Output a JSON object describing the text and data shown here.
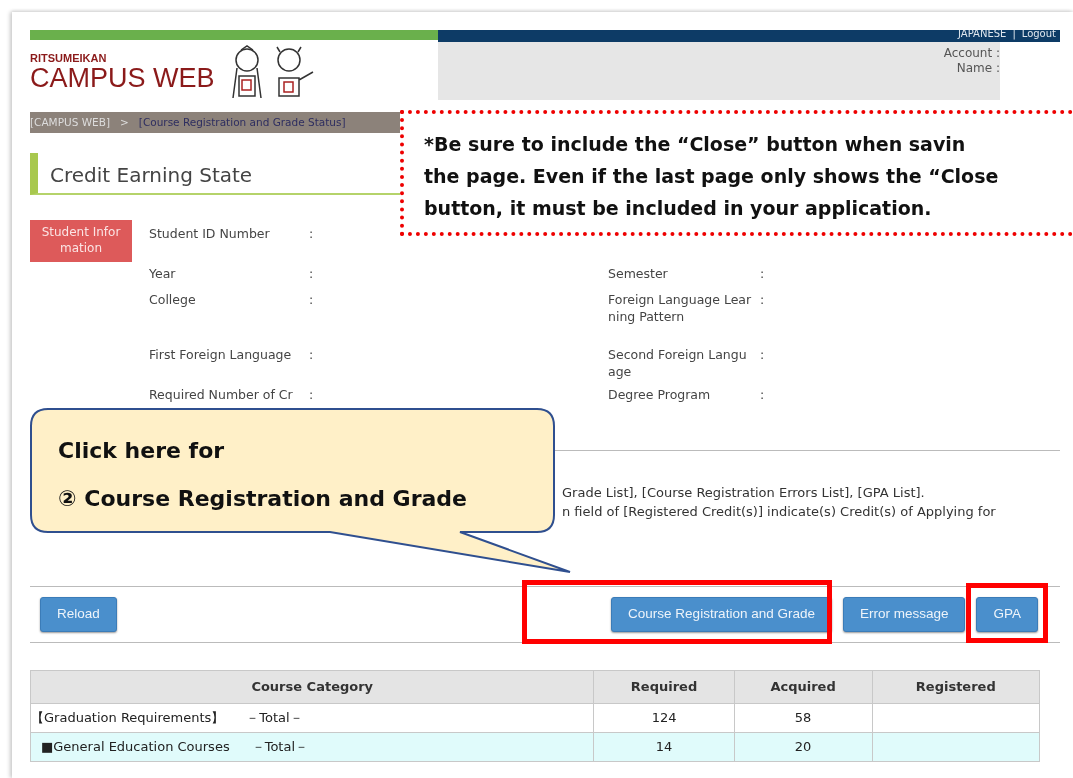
{
  "header": {
    "logo_top": "RITSUMEIKAN",
    "logo_main": "CAMPUS WEB",
    "links": [
      "JAPANESE",
      "|",
      "Logout"
    ],
    "account_label": "Account :",
    "name_label": "Name :"
  },
  "breadcrumb": [
    {
      "text": "[CAMPUS WEB]",
      "kind": "home"
    },
    {
      "text": ">",
      "kind": "sep"
    },
    {
      "text": "[Course Registration and Grade Status]",
      "kind": "current"
    }
  ],
  "page_title": "Credit Earning State",
  "student_info": {
    "badge": "Student Information",
    "rows": [
      {
        "left": {
          "label": "Student ID Number",
          "sep": ":"
        }
      },
      {
        "left": {
          "label": "Year",
          "sep": ":"
        },
        "right": {
          "label": "Semester",
          "sep": ":"
        }
      },
      {
        "left": {
          "label": "College",
          "sep": ":"
        },
        "right": {
          "label": "Foreign Language Learning Pattern",
          "sep": ":"
        }
      },
      {
        "left": {
          "label": "First Foreign Language",
          "sep": ":"
        },
        "right": {
          "label": "Second Foreign Language",
          "sep": ":"
        }
      },
      {
        "left": {
          "label": "Required Number of Cr",
          "sep": ":"
        },
        "right": {
          "label": "Degree Program",
          "sep": ":"
        }
      }
    ]
  },
  "notes": [
    "Grade List], [Course Registration Errors List], [GPA List].",
    "n field of [Registered Credit(s)] indicate(s) Credit(s) of Applying for"
  ],
  "buttons": [
    {
      "label": "Reload"
    },
    {
      "label": "Course Registration and Grade"
    },
    {
      "label": "Error message"
    },
    {
      "label": "GPA"
    }
  ],
  "table": {
    "columns": [
      "Course Category",
      "Required",
      "Acquired",
      "Registered"
    ],
    "rows": [
      {
        "kind": "total",
        "category": "【Graduation Requirements】",
        "total": "－Total－",
        "required": "124",
        "acquired": "58"
      },
      {
        "kind": "sub",
        "category": "■General Education Courses",
        "total": "－Total－",
        "required": "14",
        "acquired": "20"
      }
    ]
  },
  "annotation_note": [
    "*Be sure to include the “Close” button when savin",
    "the page. Even if the last page only shows the “Close",
    "button, it must be included in your application."
  ],
  "annotation_callout": [
    "Click here for",
    "② Course Registration and Grade"
  ]
}
